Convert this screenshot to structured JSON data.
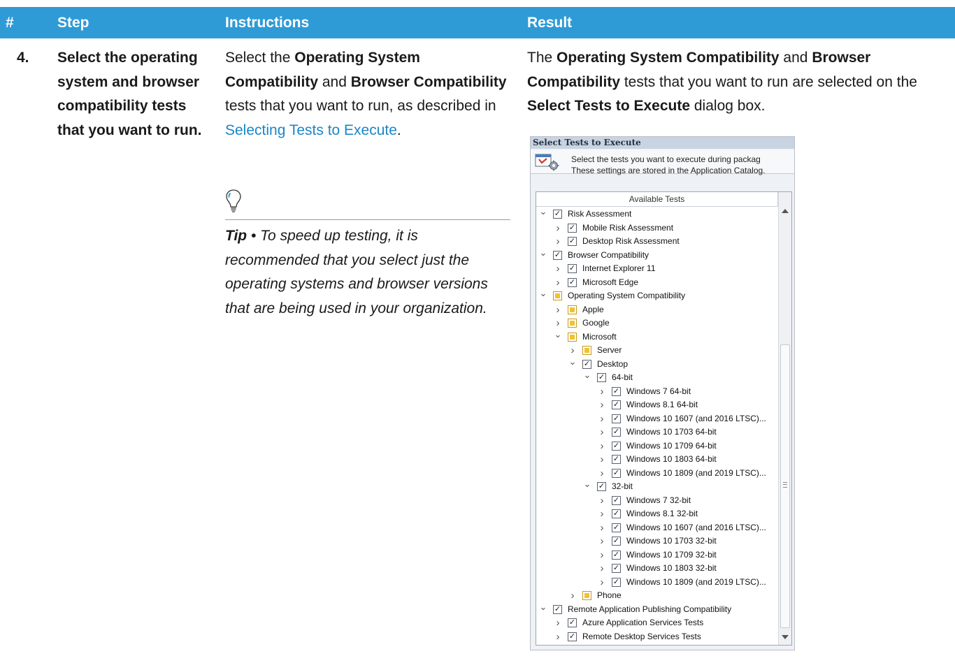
{
  "table": {
    "headers": [
      "#",
      "Step",
      "Instructions",
      "Result"
    ],
    "row": {
      "number": "4.",
      "step": "Select the operating system and browser compatibility tests that you want to run.",
      "instructions": {
        "t1": "Select the ",
        "b1": "Operating System Compatibility",
        "t2": " and ",
        "b2": "Browser Compatibility",
        "t3": " tests that you want to run, as described in ",
        "link": "Selecting Tests to Execute",
        "t4": "."
      },
      "tip": {
        "label": "Tip",
        "bullet": " • ",
        "text": "To speed up testing, it is recommended that you select just the operating systems and browser versions that are being used in your organization."
      },
      "result": {
        "t1": "The ",
        "b1": "Operating System Compatibility",
        "t2": " and ",
        "b2": "Browser Compatibility",
        "t3": " tests that you want to run are selected on the ",
        "b3": "Select Tests to Execute",
        "t4": " dialog box."
      }
    }
  },
  "dialog": {
    "title": "Select Tests to Execute",
    "desc_line1": "Select the tests you want to execute during packag",
    "desc_line2": "These settings are stored in the Application Catalog.",
    "column_header": "Available Tests",
    "tree": [
      {
        "label": "Risk Assessment",
        "level": 0,
        "expanded": true,
        "state": "checked"
      },
      {
        "label": "Mobile Risk Assessment",
        "level": 1,
        "expanded": false,
        "state": "checked"
      },
      {
        "label": "Desktop Risk Assessment",
        "level": 1,
        "expanded": false,
        "state": "checked"
      },
      {
        "label": "Browser Compatibility",
        "level": 0,
        "expanded": true,
        "state": "checked"
      },
      {
        "label": "Internet Explorer 11",
        "level": 1,
        "expanded": false,
        "state": "checked"
      },
      {
        "label": "Microsoft Edge",
        "level": 1,
        "expanded": false,
        "state": "checked"
      },
      {
        "label": "Operating System Compatibility",
        "level": 0,
        "expanded": true,
        "state": "partial"
      },
      {
        "label": "Apple",
        "level": 1,
        "expanded": false,
        "state": "partial"
      },
      {
        "label": "Google",
        "level": 1,
        "expanded": false,
        "state": "partial"
      },
      {
        "label": "Microsoft",
        "level": 1,
        "expanded": true,
        "state": "partial"
      },
      {
        "label": "Server",
        "level": 2,
        "expanded": false,
        "state": "partial"
      },
      {
        "label": "Desktop",
        "level": 2,
        "expanded": true,
        "state": "checked"
      },
      {
        "label": "64-bit",
        "level": 3,
        "expanded": true,
        "state": "checked"
      },
      {
        "label": "Windows 7 64-bit",
        "level": 4,
        "expanded": false,
        "state": "checked"
      },
      {
        "label": "Windows 8.1 64-bit",
        "level": 4,
        "expanded": false,
        "state": "checked"
      },
      {
        "label": "Windows 10 1607 (and 2016 LTSC)...",
        "level": 4,
        "expanded": false,
        "state": "checked"
      },
      {
        "label": "Windows 10 1703 64-bit",
        "level": 4,
        "expanded": false,
        "state": "checked"
      },
      {
        "label": "Windows 10 1709 64-bit",
        "level": 4,
        "expanded": false,
        "state": "checked"
      },
      {
        "label": "Windows 10 1803 64-bit",
        "level": 4,
        "expanded": false,
        "state": "checked"
      },
      {
        "label": "Windows 10 1809 (and 2019 LTSC)...",
        "level": 4,
        "expanded": false,
        "state": "checked"
      },
      {
        "label": "32-bit",
        "level": 3,
        "expanded": true,
        "state": "checked"
      },
      {
        "label": "Windows 7 32-bit",
        "level": 4,
        "expanded": false,
        "state": "checked"
      },
      {
        "label": "Windows 8.1 32-bit",
        "level": 4,
        "expanded": false,
        "state": "checked"
      },
      {
        "label": "Windows 10 1607 (and 2016 LTSC)...",
        "level": 4,
        "expanded": false,
        "state": "checked"
      },
      {
        "label": "Windows 10 1703 32-bit",
        "level": 4,
        "expanded": false,
        "state": "checked"
      },
      {
        "label": "Windows 10 1709 32-bit",
        "level": 4,
        "expanded": false,
        "state": "checked"
      },
      {
        "label": "Windows 10 1803 32-bit",
        "level": 4,
        "expanded": false,
        "state": "checked"
      },
      {
        "label": "Windows 10 1809 (and 2019 LTSC)...",
        "level": 4,
        "expanded": false,
        "state": "checked"
      },
      {
        "label": "Phone",
        "level": 2,
        "expanded": false,
        "state": "partial"
      },
      {
        "label": "Remote Application Publishing Compatibility",
        "level": 0,
        "expanded": true,
        "state": "checked"
      },
      {
        "label": "Azure Application Services Tests",
        "level": 1,
        "expanded": false,
        "state": "checked"
      },
      {
        "label": "Remote Desktop Services Tests",
        "level": 1,
        "expanded": false,
        "state": "checked"
      }
    ]
  },
  "colors": {
    "header_bg": "#2e9bd6",
    "link": "#1a86c8",
    "partial_check": "#f2c12e"
  }
}
